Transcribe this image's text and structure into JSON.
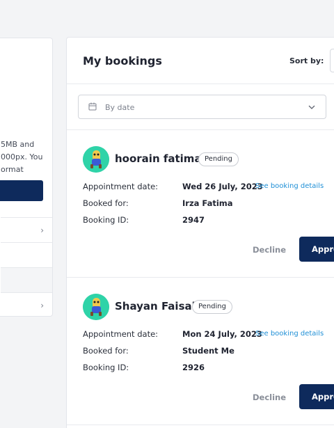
{
  "left_panel": {
    "text_lines": [
      "5MB and",
      "000px. You",
      "ormat"
    ],
    "rows": [
      {
        "chevron": "chevron-right-icon"
      },
      {
        "chevron": ""
      },
      {
        "chevron": ""
      },
      {
        "chevron": "chevron-right-icon"
      }
    ]
  },
  "bookings_panel": {
    "title": "My bookings",
    "sort_label": "Sort by:",
    "filter": {
      "label": "By date",
      "icon": "calendar-icon",
      "chevron": "chevron-down-icon"
    },
    "field_labels": {
      "appointment_date": "Appointment date:",
      "booked_for": "Booked for:",
      "booking_id": "Booking ID:"
    },
    "link_label": "See booking details",
    "decline_label": "Decline",
    "approve_label": "Approve",
    "items": [
      {
        "name": "hoorain fatima",
        "status": "Pending",
        "appointment_date": "Wed 26 July, 2023",
        "booked_for": "Irza Fatima",
        "booking_id": "2947"
      },
      {
        "name": "Shayan Faisal",
        "status": "Pending",
        "appointment_date": "Mon 24 July, 2023",
        "booked_for": "Student Me",
        "booking_id": "2926"
      }
    ]
  },
  "colors": {
    "primary": "#0e2a5c",
    "link": "#1e8fd6",
    "avatar_bg": "#2fd3a8",
    "background": "#f3f4f6"
  }
}
